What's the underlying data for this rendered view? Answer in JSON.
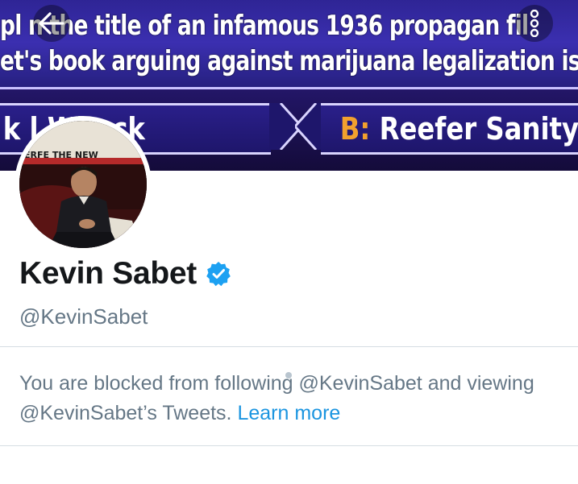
{
  "banner": {
    "question_line1": "pl  n the title of an infamous 1936 propagan    fil",
    "question_line2": "et's book arguing against marijuana legalization is ca",
    "answer_a": "k l    Whack",
    "answer_b_option": "B:",
    "answer_b_text": " Reefer Sanity",
    "photo_backdrop_text": "ERFE  THE NEW"
  },
  "header": {
    "back_icon": "back-arrow-icon",
    "more_icon": "more-vertical-icon"
  },
  "profile": {
    "display_name": "Kevin Sabet",
    "handle": "@KevinSabet",
    "verified_icon": "verified-badge-icon",
    "verified_color": "#1da1f2"
  },
  "blocked_notice": {
    "text": "You are blocked from following @KevinSabet and viewing @KevinSabet’s Tweets.",
    "link_text": "Learn more",
    "link_color": "#1b95e0"
  }
}
